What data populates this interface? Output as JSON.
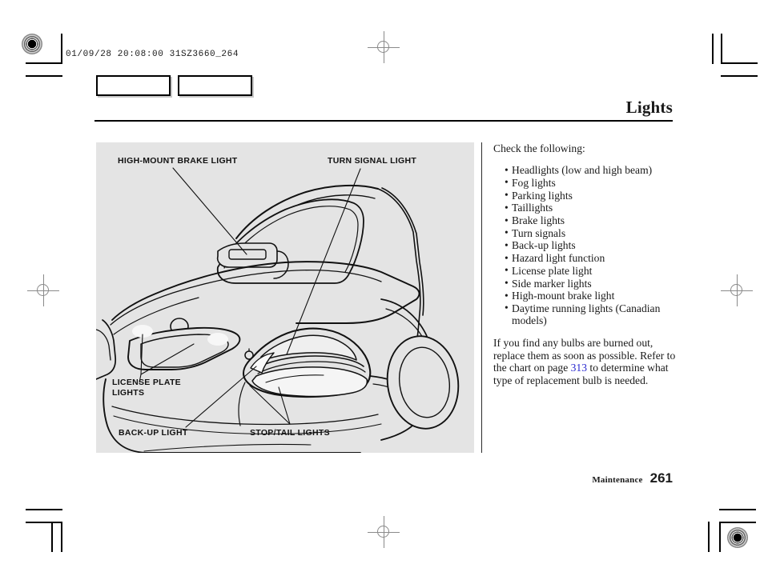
{
  "print_slug": "01/09/28 20:08:00 31SZ3660_264",
  "page_title": "Lights",
  "figure": {
    "labels": [
      {
        "id": "high-mount-brake-light",
        "text": "HIGH-MOUNT BRAKE LIGHT"
      },
      {
        "id": "turn-signal-light",
        "text": "TURN SIGNAL LIGHT"
      },
      {
        "id": "license-plate-lights",
        "text": "LICENSE PLATE\nLIGHTS"
      },
      {
        "id": "back-up-light",
        "text": "BACK-UP LIGHT"
      },
      {
        "id": "stop-tail-lights",
        "text": "STOP/TAIL LIGHTS"
      }
    ],
    "subject": "rear three-quarter view of sedan showing exterior lights",
    "background_color": "#e4e4e4"
  },
  "body": {
    "intro": "Check the following:",
    "items": [
      "Headlights (low and high beam)",
      "Fog lights",
      "Parking lights",
      "Taillights",
      "Brake lights",
      "Turn signals",
      "Back-up lights",
      "Hazard light function",
      "License plate light",
      "Side marker lights",
      "High-mount brake light",
      "Daytime running lights (Canadian models)"
    ],
    "closing_before": "If you find any bulbs are burned out, replace them as soon as possible. Refer to the chart on page ",
    "closing_xref": "313",
    "closing_after": " to determine what type of replacement bulb is needed.",
    "xref_color": "#2a2ad0"
  },
  "footer": {
    "section": "Maintenance",
    "page_number": "261"
  }
}
